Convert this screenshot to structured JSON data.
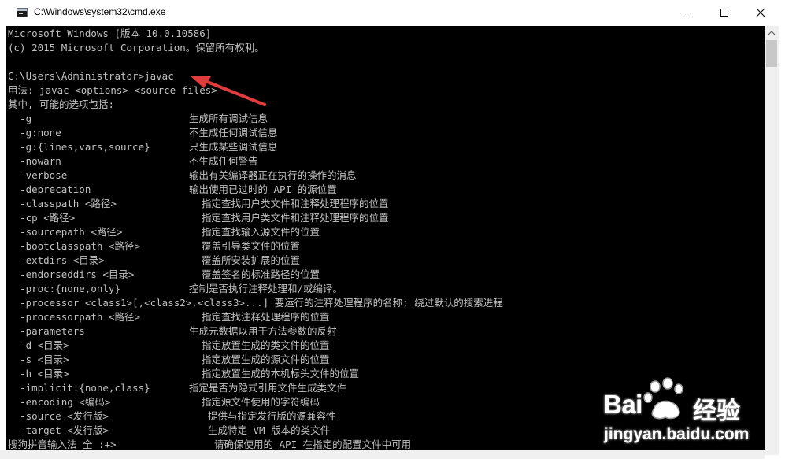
{
  "window": {
    "title": "C:\\Windows\\system32\\cmd.exe",
    "controls": {
      "minimize": "minimize-icon",
      "maximize": "maximize-icon",
      "close": "close-icon"
    }
  },
  "console": {
    "lines": [
      {
        "t": "Microsoft Windows [版本 10.0.10586]"
      },
      {
        "t": "(c) 2015 Microsoft Corporation。保留所有权利。"
      },
      {
        "t": ""
      },
      {
        "t": "C:\\Users\\Administrator>javac"
      },
      {
        "t": "用法: javac <options> <source files>"
      },
      {
        "t": "其中, 可能的选项包括:"
      },
      {
        "t": "  -g",
        "d": "生成所有调试信息",
        "c": 232
      },
      {
        "t": "  -g:none",
        "d": "不生成任何调试信息",
        "c": 232
      },
      {
        "t": "  -g:{lines,vars,source}",
        "d": "只生成某些调试信息",
        "c": 232
      },
      {
        "t": "  -nowarn",
        "d": "不生成任何警告",
        "c": 232
      },
      {
        "t": "  -verbose",
        "d": "输出有关编译器正在执行的操作的消息",
        "c": 232
      },
      {
        "t": "  -deprecation",
        "d": "输出使用已过时的 API 的源位置",
        "c": 232
      },
      {
        "t": "  -classpath <路径>",
        "d": "指定查找用户类文件和注释处理程序的位置",
        "c": 248
      },
      {
        "t": "  -cp <路径>",
        "d": "指定查找用户类文件和注释处理程序的位置",
        "c": 248
      },
      {
        "t": "  -sourcepath <路径>",
        "d": "指定查找输入源文件的位置",
        "c": 248
      },
      {
        "t": "  -bootclasspath <路径>",
        "d": "覆盖引导类文件的位置",
        "c": 248
      },
      {
        "t": "  -extdirs <目录>",
        "d": "覆盖所安装扩展的位置",
        "c": 248
      },
      {
        "t": "  -endorseddirs <目录>",
        "d": "覆盖签名的标准路径的位置",
        "c": 248
      },
      {
        "t": "  -proc:{none,only}",
        "d": "控制是否执行注释处理和/或编译。",
        "c": 232
      },
      {
        "t": "  -processor <class1>[,<class2>,<class3>...] 要运行的注释处理程序的名称; 绕过默认的搜索进程"
      },
      {
        "t": "  -processorpath <路径>",
        "d": "指定查找注释处理程序的位置",
        "c": 248
      },
      {
        "t": "  -parameters",
        "d": "生成元数据以用于方法参数的反射",
        "c": 232
      },
      {
        "t": "  -d <目录>",
        "d": "指定放置生成的类文件的位置",
        "c": 248
      },
      {
        "t": "  -s <目录>",
        "d": "指定放置生成的源文件的位置",
        "c": 248
      },
      {
        "t": "  -h <目录>",
        "d": "指定放置生成的本机标头文件的位置",
        "c": 248
      },
      {
        "t": "  -implicit:{none,class}",
        "d": "指定是否为隐式引用文件生成类文件",
        "c": 232
      },
      {
        "t": "  -encoding <编码>",
        "d": "指定源文件使用的字符编码",
        "c": 248
      },
      {
        "t": "  -source <发行版>",
        "d": "提供与指定发行版的源兼容性",
        "c": 256
      },
      {
        "t": "  -target <发行版>",
        "d": "生成特定 VM 版本的类文件",
        "c": 256
      },
      {
        "t": "搜狗拼音输入法 全 :+>",
        "d": "请确保使用的 API 在指定的配置文件中可用",
        "c": 264
      }
    ]
  },
  "annotation": {
    "arrow_color": "#e03c3c"
  },
  "watermark": {
    "brand": "Bai",
    "brand_cn": "经验",
    "url": "jingyan.baidu.com"
  },
  "colors": {
    "console_bg": "#000000",
    "console_fg": "#c0c0c0",
    "titlebar_bg": "#ffffff"
  }
}
